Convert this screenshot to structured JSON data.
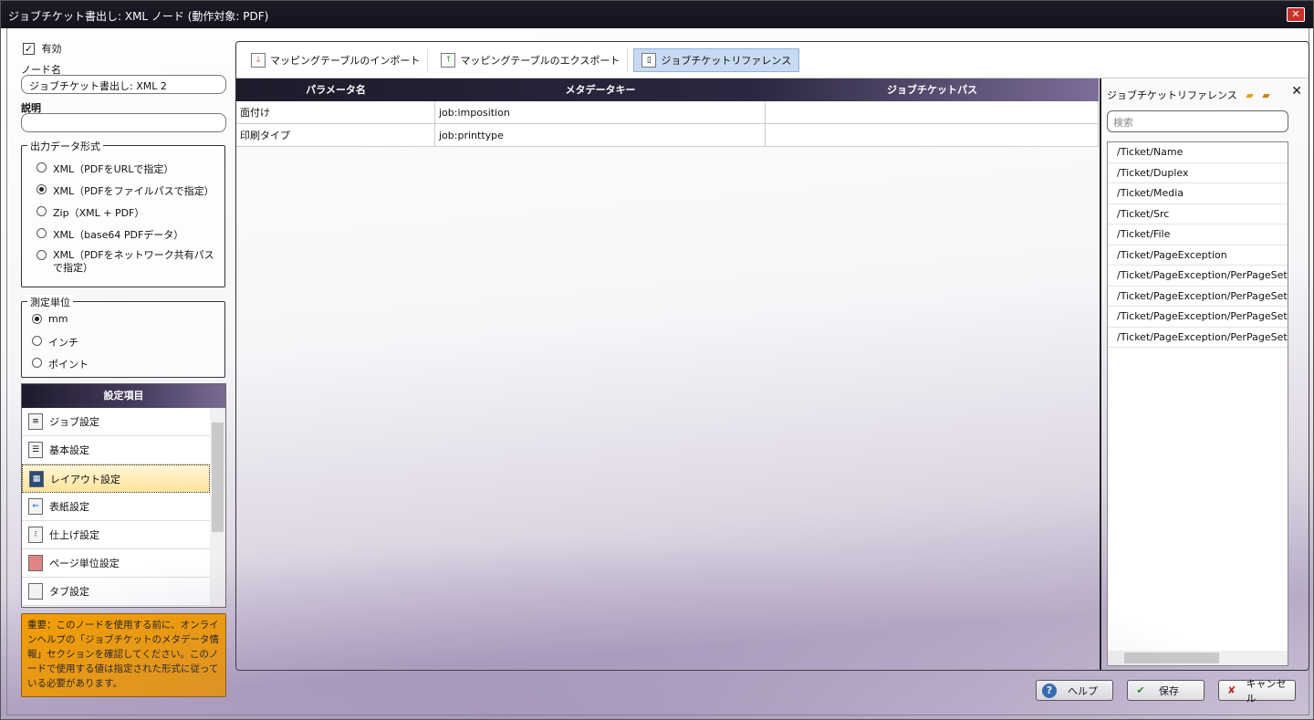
{
  "window": {
    "title": "ジョブチケット書出し: XML ノード (動作対象: PDF)",
    "close": "✕"
  },
  "left": {
    "enabled_label": "有効",
    "enabled": true,
    "node_name_label": "ノード名",
    "node_name_value": "ジョブチケット書出し: XML 2",
    "desc_label": "説明",
    "desc_value": "",
    "output_format": {
      "title": "出力データ形式",
      "options": [
        "XML（PDFをURLで指定）",
        "XML（PDFをファイルパスで指定）",
        "Zip（XML + PDF）",
        "XML（base64 PDFデータ）",
        "XML（PDFをネットワーク共有パスで指定）"
      ],
      "selected": 1
    },
    "unit": {
      "title": "測定単位",
      "options": [
        "mm",
        "インチ",
        "ポイント"
      ],
      "selected": 0
    },
    "settings": {
      "title": "設定項目",
      "items": [
        "ジョブ設定",
        "基本設定",
        "レイアウト設定",
        "表紙設定",
        "仕上げ設定",
        "ページ単位設定",
        "タブ設定"
      ],
      "selected": 2
    },
    "note": "重要：このノードを使用する前に、オンラインヘルプの「ジョブチケットのメタデータ情報」セクションを確認してください。このノードで使用する値は指定された形式に従っている必要があります。"
  },
  "toolbar": {
    "import": "マッピングテーブルのインポート",
    "export": "マッピングテーブルのエクスポート",
    "reference": "ジョブチケットリファレンス"
  },
  "grid": {
    "headers": [
      "パラメータ名",
      "メタデータキー",
      "ジョブチケットパス"
    ],
    "rows": [
      [
        "面付け",
        "job:imposition",
        ""
      ],
      [
        "印刷タイプ",
        "job:printtype",
        ""
      ]
    ]
  },
  "ref": {
    "title": "ジョブチケットリファレンス",
    "search_placeholder": "検索",
    "items": [
      "/Ticket/Name",
      "/Ticket/Duplex",
      "/Ticket/Media",
      "/Ticket/Src",
      "/Ticket/File",
      "/Ticket/PageException",
      "/Ticket/PageException/PerPageSettings",
      "/Ticket/PageException/PerPageSettings",
      "/Ticket/PageException/PerPageSettings",
      "/Ticket/PageException/PerPageSettings"
    ]
  },
  "buttons": {
    "help": "ヘルプ",
    "save": "保存",
    "cancel": "キャンセル"
  }
}
